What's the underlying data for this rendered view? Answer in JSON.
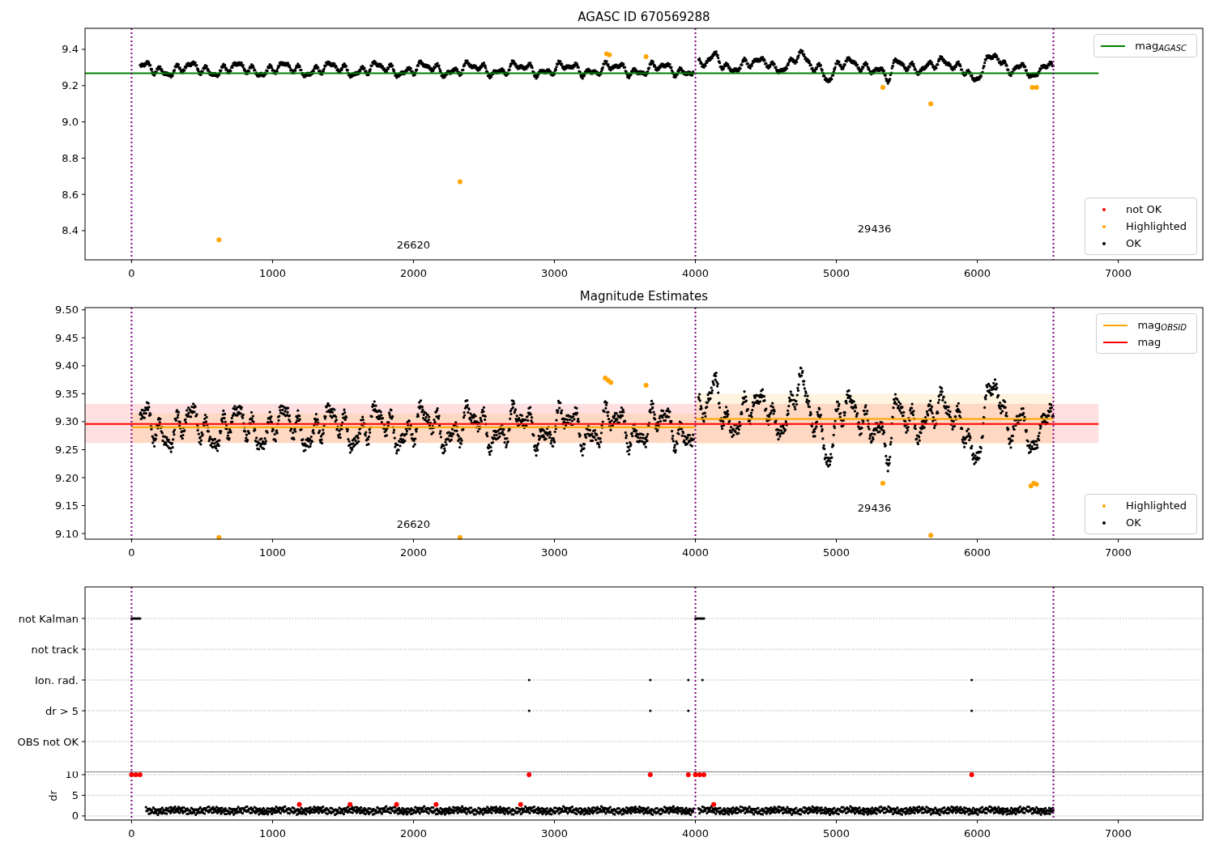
{
  "charts": [
    {
      "kind": "magnitude",
      "legends": [
        {
          "entries": [
            {
              "label": "mag$_{AGASC}$",
              "kind": "line",
              "color": "#008000"
            }
          ]
        },
        {
          "entries": [
            {
              "label": "not OK",
              "kind": "marker",
              "color": "#ff0000"
            },
            {
              "label": "Highlighted",
              "kind": "marker",
              "color": "#ffa500"
            },
            {
              "label": "OK",
              "kind": "marker",
              "color": "#000000"
            }
          ]
        }
      ],
      "chart_data": {
        "type": "scatter",
        "title": "AGASC ID 670569288",
        "xlim": [
          -330,
          7600
        ],
        "ylim": [
          8.239,
          9.516
        ],
        "xticks": [
          0,
          1000,
          2000,
          3000,
          4000,
          5000,
          6000,
          7000
        ],
        "yticks": [
          {
            "value": 8.4,
            "label": "8.4"
          },
          {
            "value": 8.6,
            "label": "8.6"
          },
          {
            "value": 8.8,
            "label": "8.8"
          },
          {
            "value": 9.0,
            "label": "9.0"
          },
          {
            "value": 9.2,
            "label": "9.2"
          },
          {
            "value": 9.4,
            "label": "9.4"
          }
        ],
        "series": [
          {
            "color": "#ffa500",
            "x": [
              620,
              2330,
              3370,
              3390,
              3650,
              5330,
              5670,
              6390,
              6420
            ],
            "values": [
              8.35,
              8.67,
              9.375,
              9.37,
              9.36,
              9.19,
              9.1,
              9.19,
              9.19
            ]
          }
        ],
        "ref_lines": [
          {
            "axis": "y",
            "value": 9.268,
            "color": "#008000"
          },
          {
            "axis": "x",
            "value": 0
          },
          {
            "axis": "x",
            "value": 4000
          },
          {
            "axis": "x",
            "value": 6540
          }
        ],
        "annotations": [
          "26620",
          "29436"
        ]
      }
    },
    {
      "kind": "magnitude",
      "legends": [
        {
          "entries": [
            {
              "label": "mag$_{OBSID}$",
              "kind": "line",
              "color": "#ffa500"
            },
            {
              "label": "mag",
              "kind": "line",
              "color": "#ff0000"
            }
          ]
        },
        {
          "entries": [
            {
              "label": "Highlighted",
              "kind": "marker",
              "color": "#ffa500"
            },
            {
              "label": "OK",
              "kind": "marker",
              "color": "#000000"
            }
          ]
        }
      ],
      "chart_data": {
        "type": "scatter",
        "title": "Magnitude Estimates",
        "xlim": [
          -330,
          7600
        ],
        "ylim": [
          9.09,
          9.504
        ],
        "xticks": [
          0,
          1000,
          2000,
          3000,
          4000,
          5000,
          6000,
          7000
        ],
        "yticks": [
          {
            "value": 9.1,
            "label": "9.10"
          },
          {
            "value": 9.15,
            "label": "9.15"
          },
          {
            "value": 9.2,
            "label": "9.20"
          },
          {
            "value": 9.25,
            "label": "9.25"
          },
          {
            "value": 9.3,
            "label": "9.30"
          },
          {
            "value": 9.35,
            "label": "9.35"
          },
          {
            "value": 9.4,
            "label": "9.40"
          },
          {
            "value": 9.45,
            "label": "9.45"
          },
          {
            "value": 9.5,
            "label": "9.50"
          }
        ],
        "series": [
          {
            "type": "line",
            "color": "#ffa500",
            "x": [
              0,
              4000
            ],
            "values": [
              9.29,
              9.29
            ]
          },
          {
            "type": "line",
            "color": "#ffa500",
            "x": [
              4000,
              6540
            ],
            "values": [
              9.305,
              9.305
            ]
          },
          {
            "color": "#ffa500",
            "x": [
              620,
              2330,
              3360,
              3380,
              3400,
              3650,
              5330,
              5670,
              6380,
              6400,
              6420
            ],
            "values": [
              9.093,
              9.093,
              9.378,
              9.374,
              9.37,
              9.365,
              9.19,
              9.097,
              9.185,
              9.19,
              9.188
            ]
          }
        ],
        "bands": [
          {
            "axis": "y",
            "from": 9.262,
            "to": 9.332,
            "color": "#ff0000"
          },
          {
            "axis": "y",
            "from": 9.262,
            "to": 9.315,
            "color": "#ffa500"
          },
          {
            "axis": "y",
            "from": 9.26,
            "to": 9.35,
            "color": "#ffa500"
          }
        ],
        "ref_lines": [
          {
            "axis": "y",
            "value": 9.296,
            "color": "#ff0000"
          },
          {
            "axis": "x",
            "value": 0
          },
          {
            "axis": "x",
            "value": 4000
          },
          {
            "axis": "x",
            "value": 6540
          }
        ],
        "annotations": [
          "26620",
          "29436"
        ]
      }
    },
    {
      "kind": "flags",
      "rows": [
        "not Kalman",
        "not track",
        "Ion. rad.",
        "dr > 5",
        "OBS not OK"
      ]
    },
    {
      "kind": "dr",
      "chart_data": {
        "type": "scatter",
        "ylabel": "dr",
        "grid": true,
        "xlim": [
          -330,
          7600
        ],
        "ylim": [
          -1,
          10.78
        ],
        "xticks": [
          0,
          1000,
          2000,
          3000,
          4000,
          5000,
          6000,
          7000
        ],
        "yticks": [
          {
            "value": 0,
            "label": "0"
          },
          {
            "value": 5,
            "label": "5"
          },
          {
            "value": 10,
            "label": "10"
          }
        ],
        "series": [
          {
            "color": "#ff0000",
            "x": [
              0,
              30,
              60,
              2820,
              3680,
              3950,
              4000,
              4030,
              4060,
              5960
            ],
            "values": [
              10,
              10,
              10,
              10,
              10,
              10,
              10,
              10,
              10,
              10
            ]
          },
          {
            "color": "#ff0000",
            "x": [
              1190,
              1550,
              1880,
              2160,
              2760,
              4130
            ],
            "values": [
              2.8,
              2.8,
              2.8,
              2.8,
              2.8,
              2.8
            ]
          }
        ],
        "ref_lines": [
          {
            "axis": "x",
            "value": 0
          },
          {
            "axis": "x",
            "value": 4000
          },
          {
            "axis": "x",
            "value": 6540
          }
        ]
      }
    }
  ]
}
